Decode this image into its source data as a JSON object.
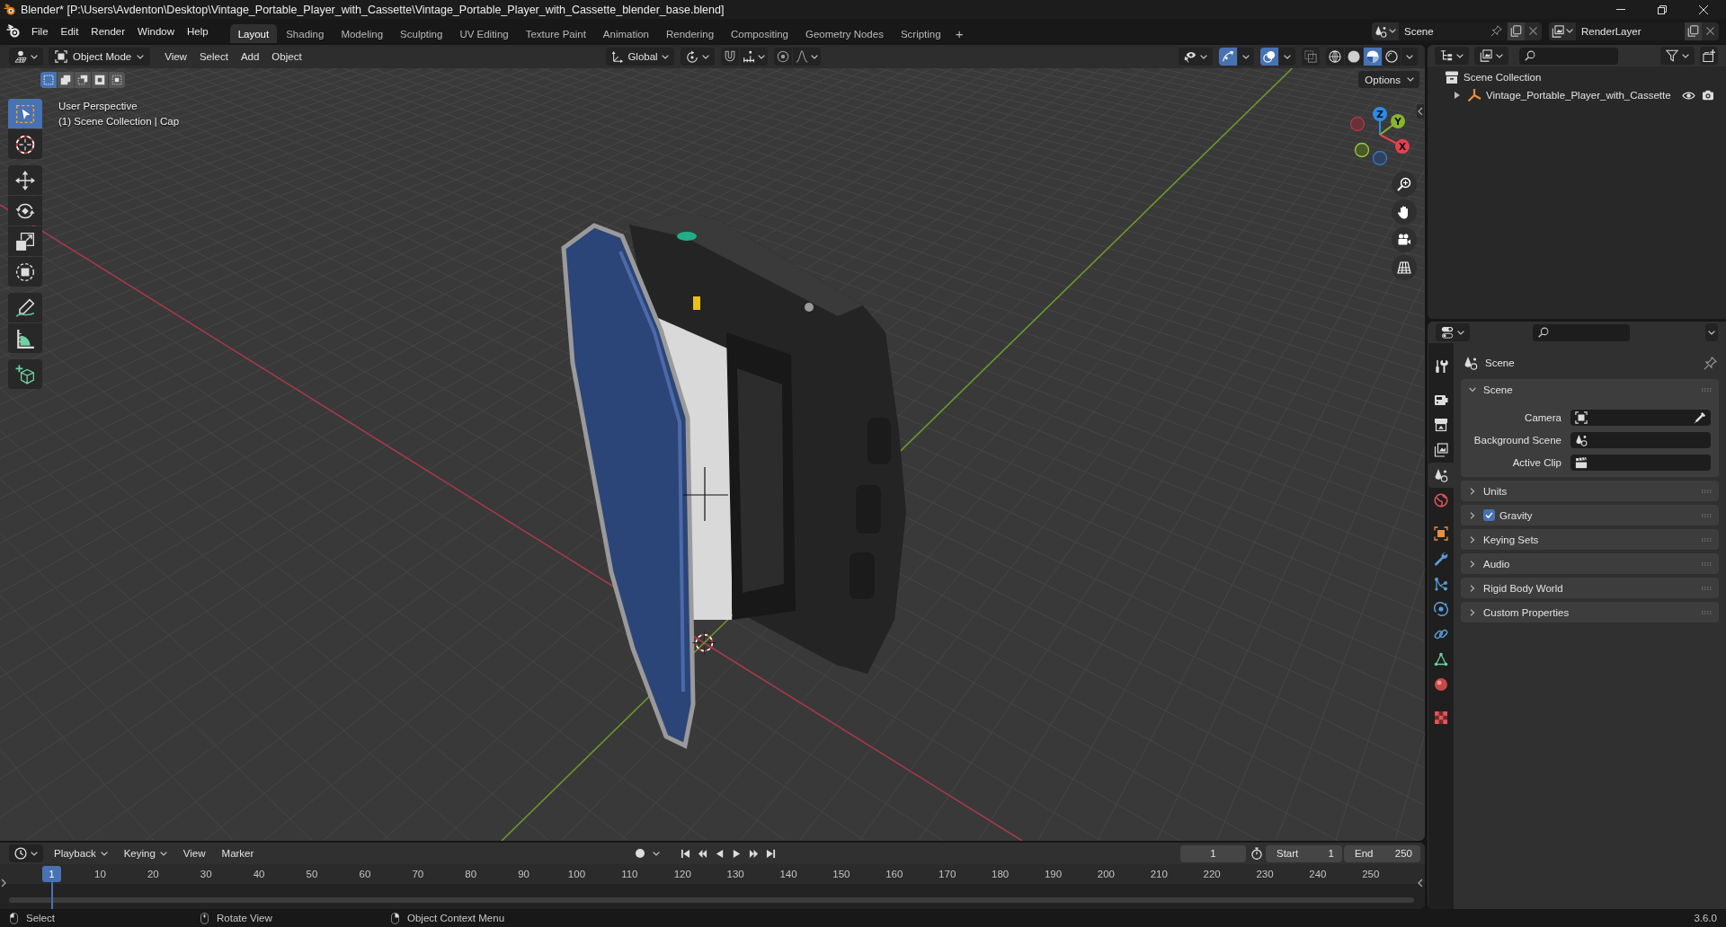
{
  "title_bar": {
    "title": "Blender* [P:\\Users\\Avdenton\\Desktop\\Vintage_Portable_Player_with_Cassette\\Vintage_Portable_Player_with_Cassette_blender_base.blend]"
  },
  "top_bar": {
    "menus": [
      "File",
      "Edit",
      "Render",
      "Window",
      "Help"
    ],
    "workspaces": [
      {
        "label": "Layout",
        "selected": true
      },
      {
        "label": "Shading",
        "selected": false
      },
      {
        "label": "Modeling",
        "selected": false
      },
      {
        "label": "Sculpting",
        "selected": false
      },
      {
        "label": "UV Editing",
        "selected": false
      },
      {
        "label": "Texture Paint",
        "selected": false
      },
      {
        "label": "Animation",
        "selected": false
      },
      {
        "label": "Rendering",
        "selected": false
      },
      {
        "label": "Compositing",
        "selected": false
      },
      {
        "label": "Geometry Nodes",
        "selected": false
      },
      {
        "label": "Scripting",
        "selected": false
      }
    ],
    "add_workspace": "+",
    "scene": "Scene",
    "view_layer": "RenderLayer"
  },
  "viewport": {
    "header": {
      "mode": "Object Mode",
      "menus": [
        "View",
        "Select",
        "Add",
        "Object"
      ],
      "orientation": "Global",
      "snap_on": false,
      "proportional_on": false,
      "gizmos_on": true,
      "overlays_on": true,
      "xray_on": false,
      "shading": [
        {
          "kind": "wireframe",
          "selected": false
        },
        {
          "kind": "solid",
          "selected": false
        },
        {
          "kind": "material",
          "selected": true
        },
        {
          "kind": "rendered",
          "selected": false
        }
      ]
    },
    "select_modes": [
      {
        "kind": "new",
        "selected": true
      },
      {
        "kind": "extend",
        "selected": false
      },
      {
        "kind": "subtract",
        "selected": false
      },
      {
        "kind": "invert",
        "selected": false
      },
      {
        "kind": "intersect",
        "selected": false
      }
    ],
    "options": "Options",
    "tool_groups": [
      [
        {
          "kind": "select_box",
          "selected": true
        },
        {
          "kind": "cursor",
          "selected": false
        }
      ],
      [
        {
          "kind": "move",
          "selected": false
        },
        {
          "kind": "rotate",
          "selected": false
        },
        {
          "kind": "scale",
          "selected": false
        },
        {
          "kind": "transform",
          "selected": false
        }
      ],
      [
        {
          "kind": "annotate",
          "selected": false
        },
        {
          "kind": "measure",
          "selected": false
        }
      ],
      [
        {
          "kind": "add_cube",
          "selected": false
        }
      ]
    ],
    "view_name": "User Perspective",
    "view_context": "(1) Scene Collection | Cap",
    "gizmo_axes": [
      "Z",
      "Y",
      "X"
    ]
  },
  "outliner": {
    "tree": [
      {
        "label": "Scene Collection",
        "kind": "collection",
        "children": [
          {
            "label": "Vintage_Portable_Player_with_Cassette",
            "kind": "empty",
            "expanded": false
          }
        ]
      }
    ]
  },
  "properties": {
    "tab_groups": [
      [
        {
          "kind": "tool",
          "selected": false
        }
      ],
      [
        {
          "kind": "render",
          "selected": false
        },
        {
          "kind": "output",
          "selected": false
        },
        {
          "kind": "view_layer",
          "selected": false
        },
        {
          "kind": "scene",
          "selected": true
        },
        {
          "kind": "world",
          "selected": false
        }
      ],
      [
        {
          "kind": "object",
          "selected": false
        },
        {
          "kind": "modifiers",
          "selected": false
        },
        {
          "kind": "particles",
          "selected": false
        },
        {
          "kind": "physics",
          "selected": false
        },
        {
          "kind": "constraints",
          "selected": false
        },
        {
          "kind": "data",
          "selected": false
        },
        {
          "kind": "material",
          "selected": false
        }
      ],
      [
        {
          "kind": "texture",
          "selected": false
        }
      ]
    ],
    "context": "Scene",
    "panels": [
      {
        "title": "Scene",
        "expanded": true,
        "fields": [
          {
            "label": "Camera",
            "kind": "camera",
            "eyedropper": true
          },
          {
            "label": "Background Scene",
            "kind": "scene"
          },
          {
            "label": "Active Clip",
            "kind": "clip"
          }
        ]
      },
      {
        "title": "Units",
        "expanded": false
      },
      {
        "title": "Gravity",
        "expanded": false,
        "checked": true
      },
      {
        "title": "Keying Sets",
        "expanded": false
      },
      {
        "title": "Audio",
        "expanded": false
      },
      {
        "title": "Rigid Body World",
        "expanded": false
      },
      {
        "title": "Custom Properties",
        "expanded": false
      }
    ]
  },
  "timeline": {
    "menus": [
      {
        "label": "Playback",
        "dropdown": true
      },
      {
        "label": "Keying",
        "dropdown": true
      },
      {
        "label": "View",
        "dropdown": false
      },
      {
        "label": "Marker",
        "dropdown": false
      }
    ],
    "current_frame": "1",
    "start_label": "Start",
    "start": "1",
    "end_label": "End",
    "end": "250",
    "playhead": "1",
    "ruler": [
      "10",
      "20",
      "30",
      "40",
      "50",
      "60",
      "70",
      "80",
      "90",
      "100",
      "110",
      "120",
      "130",
      "140",
      "150",
      "160",
      "170",
      "180",
      "190",
      "200",
      "210",
      "220",
      "230",
      "240",
      "250"
    ]
  },
  "status_bar": {
    "hints": [
      {
        "kind": "left",
        "label": "Select"
      },
      {
        "kind": "middle",
        "label": "Rotate View"
      },
      {
        "kind": "right",
        "label": "Object Context Menu"
      }
    ],
    "version": "3.6.0"
  }
}
